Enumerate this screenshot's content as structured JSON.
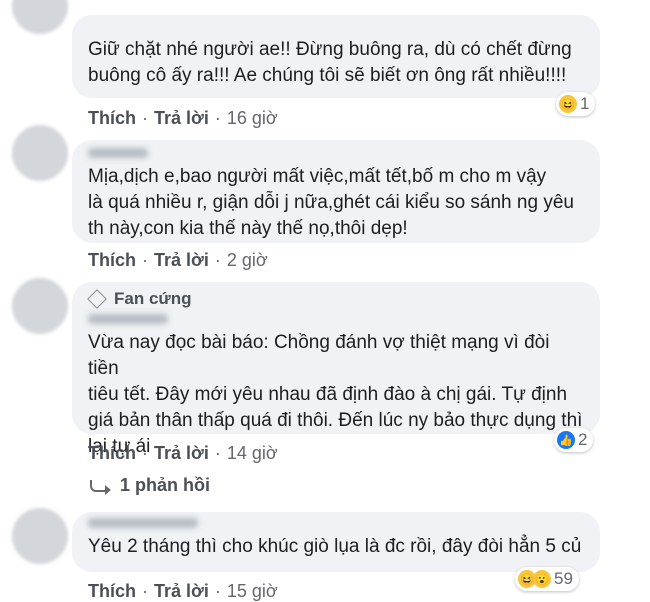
{
  "comments": [
    {
      "text": "Giữ chặt nhé người ae!! Đừng buông ra, dù có chết đừng\nbuông cô ấy ra!!! Ae chúng tôi sẽ biết ơn ông rất nhiều!!!!",
      "like": "Thích",
      "reply": "Trả lời",
      "time": "16 giờ",
      "reaction_count": "1",
      "reaction_icons": [
        "haha-icon"
      ]
    },
    {
      "text": "Mịa,dịch      e,bao người mất việc,mất tết,bố m cho m vậy\nlà quá nhiều r, giận dỗi j nữa,ghét cái kiểu so sánh ng yêu\nth này,con kia thế này thế nọ,thôi dẹp!",
      "like": "Thích",
      "reply": "Trả lời",
      "time": "2 giờ"
    },
    {
      "badge": "Fan cứng",
      "text": "Vừa nay đọc bài báo: Chồng đánh vợ thiệt mạng vì đòi tiền\ntiêu tết. Đây mới yêu nhau đã định đào à chị gái. Tự định\ngiá bản thân thấp quá đi thôi. Đến lúc ny bảo thực dụng thì\nlại tự ái",
      "like": "Thích",
      "reply": "Trả lời",
      "time": "14 giờ",
      "reaction_count": "2",
      "reaction_icons": [
        "like-icon"
      ],
      "replies_label": "1 phản hồi"
    },
    {
      "text": "Yêu 2 tháng thì cho khúc giò lụa là đc rồi, đây đòi hẳn 5 củ",
      "like": "Thích",
      "reply": "Trả lời",
      "time": "15 giờ",
      "reaction_count": "59",
      "reaction_icons": [
        "haha-icon",
        "wow-icon"
      ]
    }
  ],
  "colors": {
    "bubble": "#f0f2f5",
    "action_text": "#4b4f56",
    "meta_text": "#65676b",
    "like_blue": "#1877f2"
  }
}
